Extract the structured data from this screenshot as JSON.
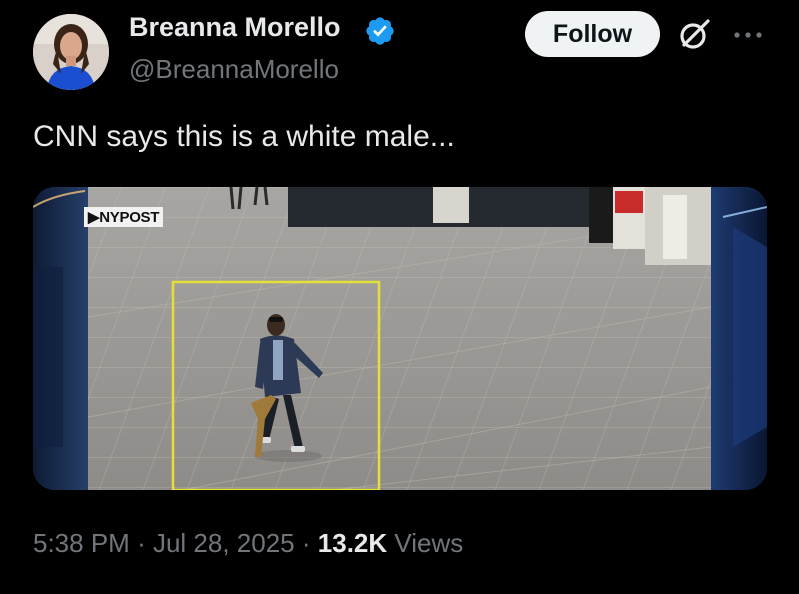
{
  "author": {
    "display_name": "Breanna Morello",
    "handle": "@BreannaMorello",
    "verified_color": "#1d9bf0"
  },
  "actions": {
    "follow_label": "Follow",
    "grok_icon": "grok-icon",
    "more_icon": "more-options-icon"
  },
  "tweet": {
    "text": "CNN says this is a white male...",
    "media": {
      "watermark": "NYPOST",
      "highlight_color": "#e4e03a"
    },
    "time": "5:38 PM",
    "separator1": "·",
    "date": "Jul 28, 2025",
    "separator2": "·",
    "views_count": "13.2K",
    "views_label": "Views"
  }
}
